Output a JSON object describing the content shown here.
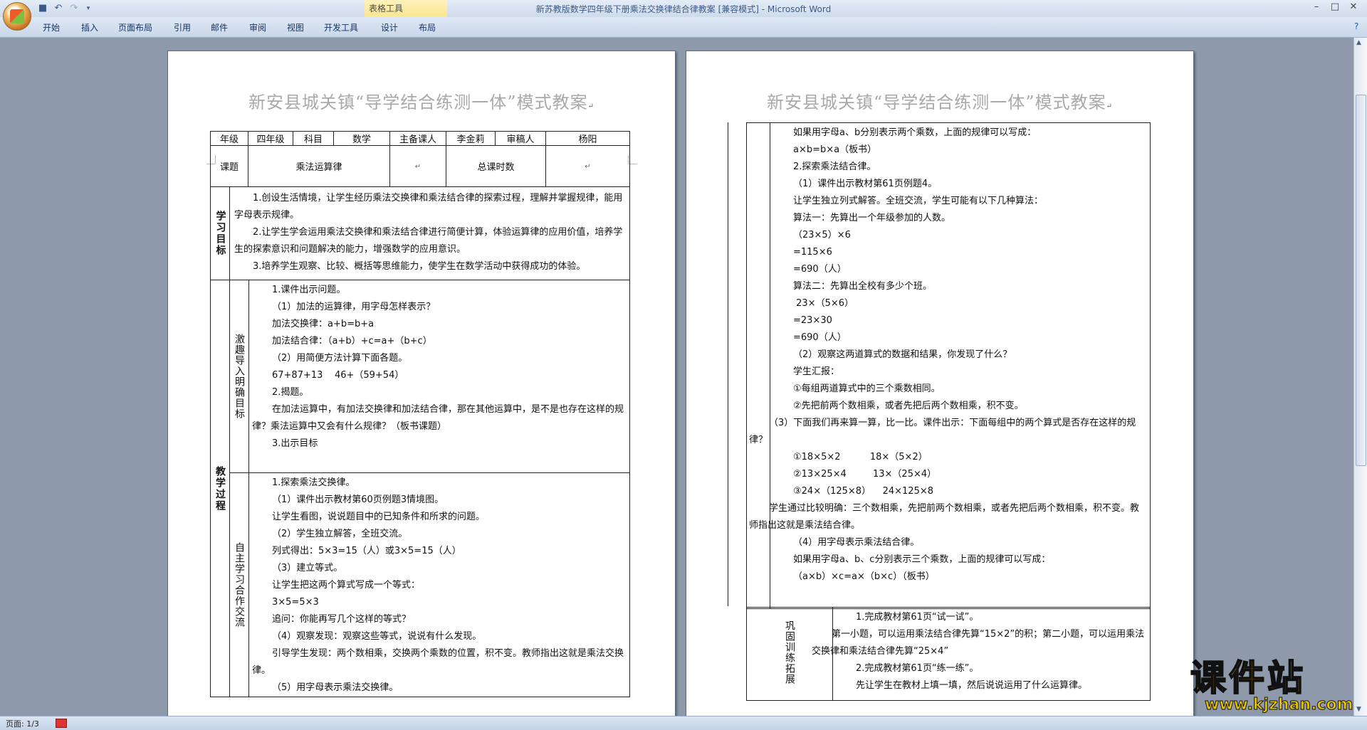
{
  "window": {
    "title": "新苏教版数学四年级下册乘法交换律结合律教案 [兼容模式] - Microsoft Word",
    "context_tab_group": "表格工具"
  },
  "ribbon": {
    "tabs": [
      "开始",
      "插入",
      "页面布局",
      "引用",
      "邮件",
      "审阅",
      "视图",
      "开发工具",
      "设计",
      "布局"
    ]
  },
  "status": {
    "page": "页面: 1/3"
  },
  "watermark": {
    "main": "课件站",
    "url": "www.kjzhan.com"
  },
  "para_mark": "↵",
  "doc_title": "新安县城关镇“导学结合练测一体”模式教案",
  "page1": {
    "header_row": [
      "年级",
      "四年级",
      "科目",
      "数学",
      "主备课人",
      "李金莉",
      "审稿人",
      "杨阳"
    ],
    "row2": {
      "label": "课题",
      "topic": "乘法运算律",
      "hours_label": "总课时数"
    },
    "goals": {
      "label": "学习目标",
      "items": [
        "1.创设生活情境，让学生经历乘法交换律和乘法结合律的探索过程，理解并掌握规律，能用字母表示规律。",
        "2.让学生学会运用乘法交换律和乘法结合律进行简便计算，体验运算律的应用价值，培养学生的探索意识和问题解决的能力，增强数学的应用意识。",
        "3.培养学生观察、比较、概括等思维能力，使学生在数学活动中获得成功的体验。"
      ]
    },
    "process_label": "教学过程",
    "section1": {
      "label": "激趣导入明确目标",
      "lines": [
        "1.课件出示问题。",
        "（1）加法的运算律，用字母怎样表示？",
        "加法交换律：a+b=b+a",
        "加法结合律：（a+b）+c=a+（b+c）",
        "（2）用简便方法计算下面各题。",
        "67+87+13    46+（59+54）",
        "2.揭题。",
        "在加法运算中，有加法交换律和加法结合律，那在其他运算中，是不是也存在这样的规律？乘法运算中又会有什么规律？（板书课题）",
        "3.出示目标"
      ]
    },
    "section2": {
      "label": "自主学习合作交流",
      "lines": [
        "1.探索乘法交换律。",
        "（1）课件出示教材第60页例题3情境图。",
        "让学生看图，说说题目中的已知条件和所求的问题。",
        "（2）学生独立解答，全班交流。",
        "列式得出：5×3=15（人）或3×5=15（人）",
        "（3）建立等式。",
        "让学生把这两个算式写成一个等式：",
        "3×5=5×3",
        "追问：你能再写几个这样的等式？",
        "（4）观察发现：观察这些等式，说说有什么发现。",
        "引导学生发现：两个数相乘，交换两个乘数的位置，积不变。教师指出这就是乘法交换律。",
        "（5）用字母表示乘法交换律。"
      ]
    }
  },
  "page2": {
    "cont_lines": [
      "如果用字母a、b分别表示两个乘数，上面的规律可以写成：",
      "a×b=b×a（板书）",
      "2.探索乘法结合律。",
      "（1）课件出示教材第61页例题4。",
      "让学生独立列式解答。全班交流，学生可能有以下几种算法：",
      "算法一：先算出一个年级参加的人数。",
      "（23×5）×6",
      "=115×6",
      "=690（人）",
      "算法二：先算出全校有多少个班。",
      " 23×（5×6）",
      "=23×30",
      "=690（人）",
      "（2）观察这两道算式的数据和结果，你发现了什么？",
      "学生汇报：",
      "①每组两道算式中的三个乘数相同。",
      "②先把前两个数相乘，或者先把后两个数相乘，积不变。",
      "（3）下面我们再来算一算，比一比。课件出示：下面每组中的两个算式是否存在这样的规律？",
      "①18×5×2          18×（5×2）",
      "②13×25×4         13×（25×4）",
      "③24×（125×8）    24×125×8",
      "学生通过比较明确：三个数相乘，先把前两个数相乘，或者先把后两个数相乘，积不变。教师指出这就是乘法结合律。",
      "（4）用字母表示乘法结合律。",
      "如果用字母a、b、c分别表示三个乘数，上面的规律可以写成：",
      "（a×b）×c=a×（b×c）（板书）"
    ],
    "practice": {
      "label": "巩固训练拓展",
      "lines": [
        "1.完成教材第61页“试一试”。",
        "第一小题，可以运用乘法结合律先算“15×2”的积；第二小题，可以运用乘法交换律和乘法结合律先算“25×4”",
        "2.完成教材第61页“练一练”。",
        "先让学生在教材上填一填，然后说说运用了什么运算律。"
      ]
    }
  }
}
